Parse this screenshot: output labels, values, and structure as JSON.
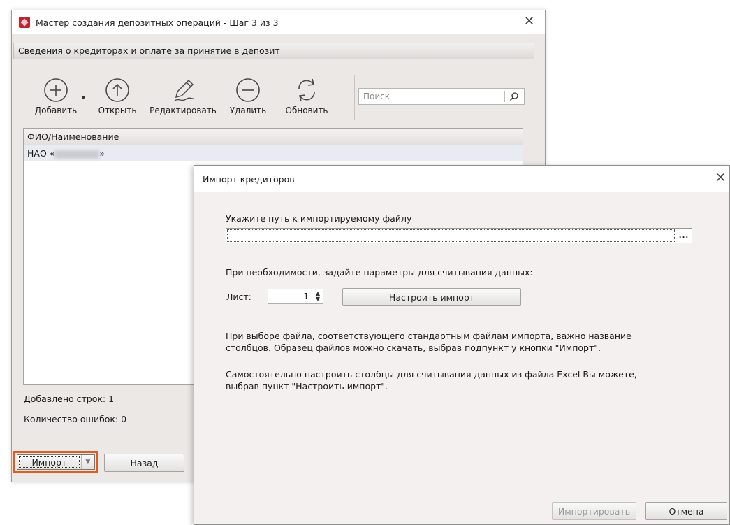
{
  "main_window": {
    "title": "Мастер создания депозитных операций - Шаг 3 из 3",
    "close_glyph": "✕",
    "section_title": "Сведения о кредиторах и оплате за принятие в депозит",
    "toolbar": {
      "add": "Добавить",
      "open": "Открыть",
      "edit": "Редактировать",
      "delete": "Удалить",
      "refresh": "Обновить"
    },
    "search_placeholder": "Поиск",
    "grid": {
      "column_header": "ФИО/Наименование",
      "row_prefix": "НАО «",
      "row_suffix": "»"
    },
    "stats": {
      "rows_added": "Добавлено строк: 1",
      "errors_count": "Количество ошибок: 0"
    },
    "buttons": {
      "import": "Импорт",
      "back": "Назад"
    },
    "accent_highlight": "#e35b1e",
    "icon_color": "#4a4a4a"
  },
  "import_dialog": {
    "title": "Импорт кредиторов",
    "close_glyph": "✕",
    "file_path_label": "Укажите путь к импортируемому файлу",
    "file_path_value": "",
    "browse_label": "...",
    "params_label": "При необходимости, задайте параметры для считывания данных:",
    "sheet_label": "Лист:",
    "sheet_value": "1",
    "configure_button": "Настроить импорт",
    "info_paragraph_1_line1": "При выборе файла, соответствующего стандартным файлам импорта, важно название",
    "info_paragraph_1_line2": "столбцов. Образец файлов можно скачать, выбрав подпункт у кнопки \"Импорт\".",
    "info_paragraph_2_line1": "Самостоятельно настроить столбцы для считывания данных из файла Excel Вы можете,",
    "info_paragraph_2_line2": "выбрав пункт \"Настроить импорт\".",
    "import_button": "Импортировать",
    "cancel_button": "Отмена"
  }
}
